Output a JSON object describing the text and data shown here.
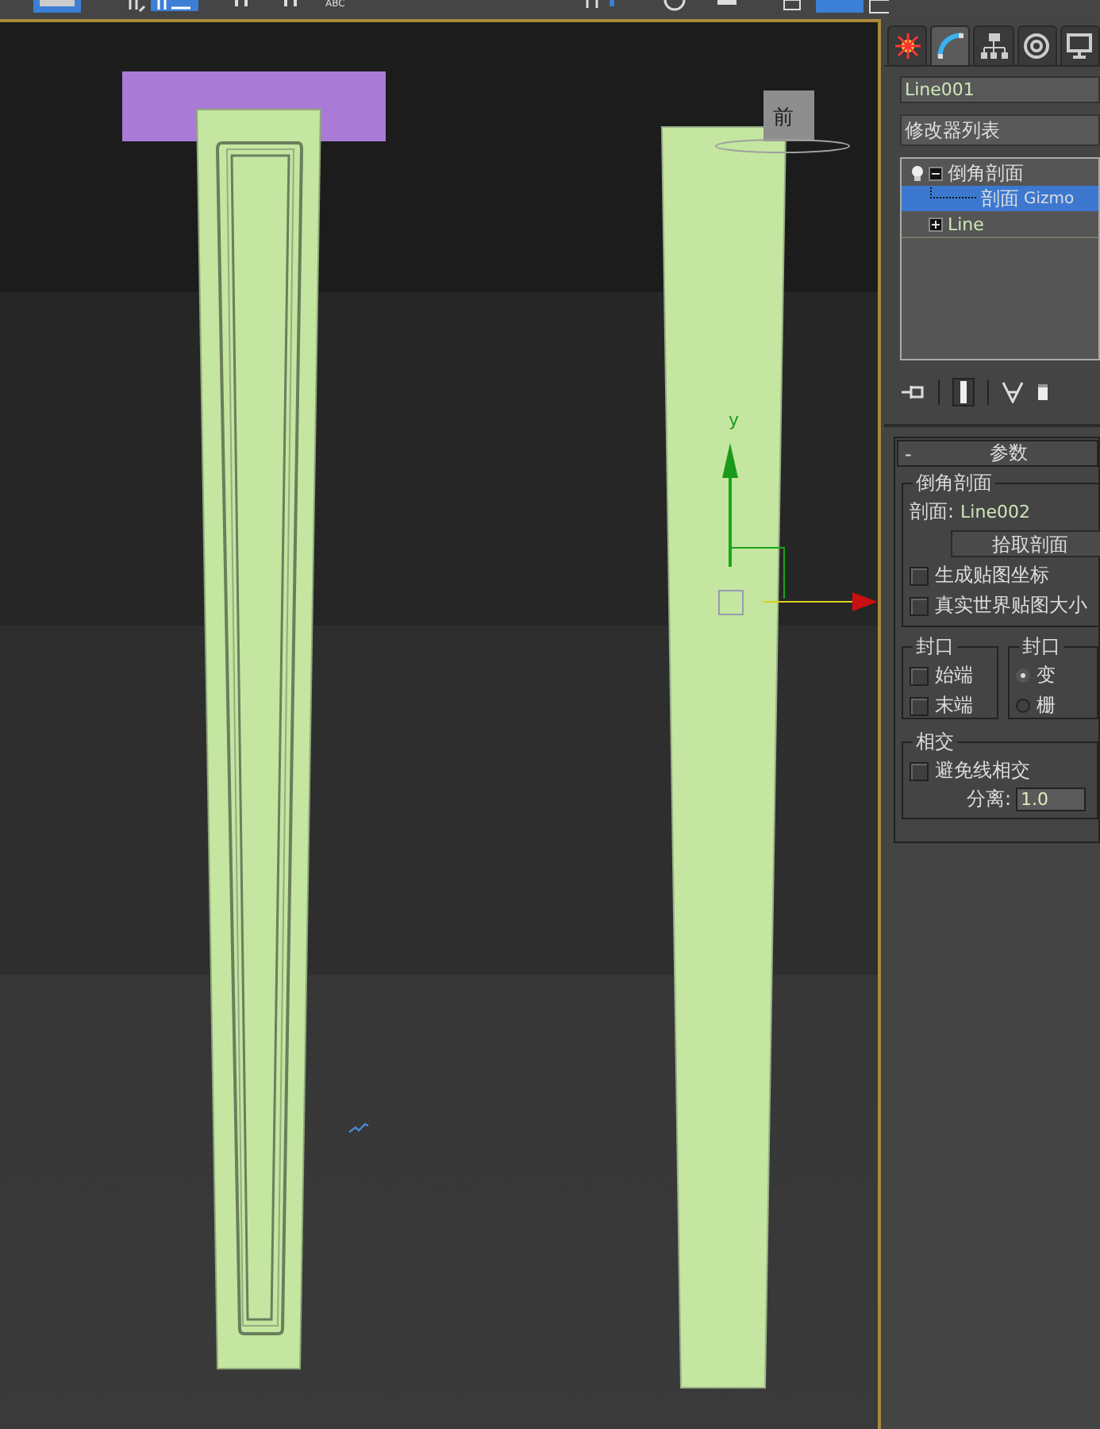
{
  "toolbar": {
    "abc_label": "ABC"
  },
  "viewport": {
    "viewcube_label": "前",
    "gizmo_axis": "y"
  },
  "command_panel": {
    "tabs": [
      {
        "kind": "create",
        "selected": false
      },
      {
        "kind": "modify",
        "selected": true
      },
      {
        "kind": "hierarchy",
        "selected": false
      },
      {
        "kind": "motion",
        "selected": false
      },
      {
        "kind": "display",
        "selected": false
      }
    ],
    "object_name": "Line001",
    "modifier_list": "修改器列表",
    "stack": [
      {
        "label": "倒角剖面",
        "expanded": true,
        "selected": false,
        "children": [
          {
            "label": "剖面",
            "suffix": "Gizmo",
            "selected": true
          }
        ]
      },
      {
        "label": "Line",
        "expanded": false,
        "selected": false
      }
    ],
    "rollout": {
      "collapse": "-",
      "title": "参数",
      "bevel_group": {
        "title": "倒角剖面",
        "profile_label": "剖面:",
        "profile_value": "Line002",
        "pick_button": "拾取剖面",
        "checks": [
          {
            "label": "生成贴图坐标",
            "checked": false
          },
          {
            "label": "真实世界贴图大小",
            "checked": false
          }
        ]
      },
      "cap_group": {
        "title": "封口",
        "checks": [
          {
            "label": "始端",
            "checked": false
          },
          {
            "label": "末端",
            "checked": false
          }
        ]
      },
      "cap_type_group": {
        "title": "封口",
        "radios": [
          {
            "label": "变",
            "selected": true
          },
          {
            "label": "栅",
            "selected": false
          }
        ]
      },
      "intersect_group": {
        "title": "相交",
        "checks": [
          {
            "label": "避免线相交",
            "checked": false
          }
        ],
        "separation_label": "分离:",
        "separation_value": "1.0"
      }
    }
  }
}
